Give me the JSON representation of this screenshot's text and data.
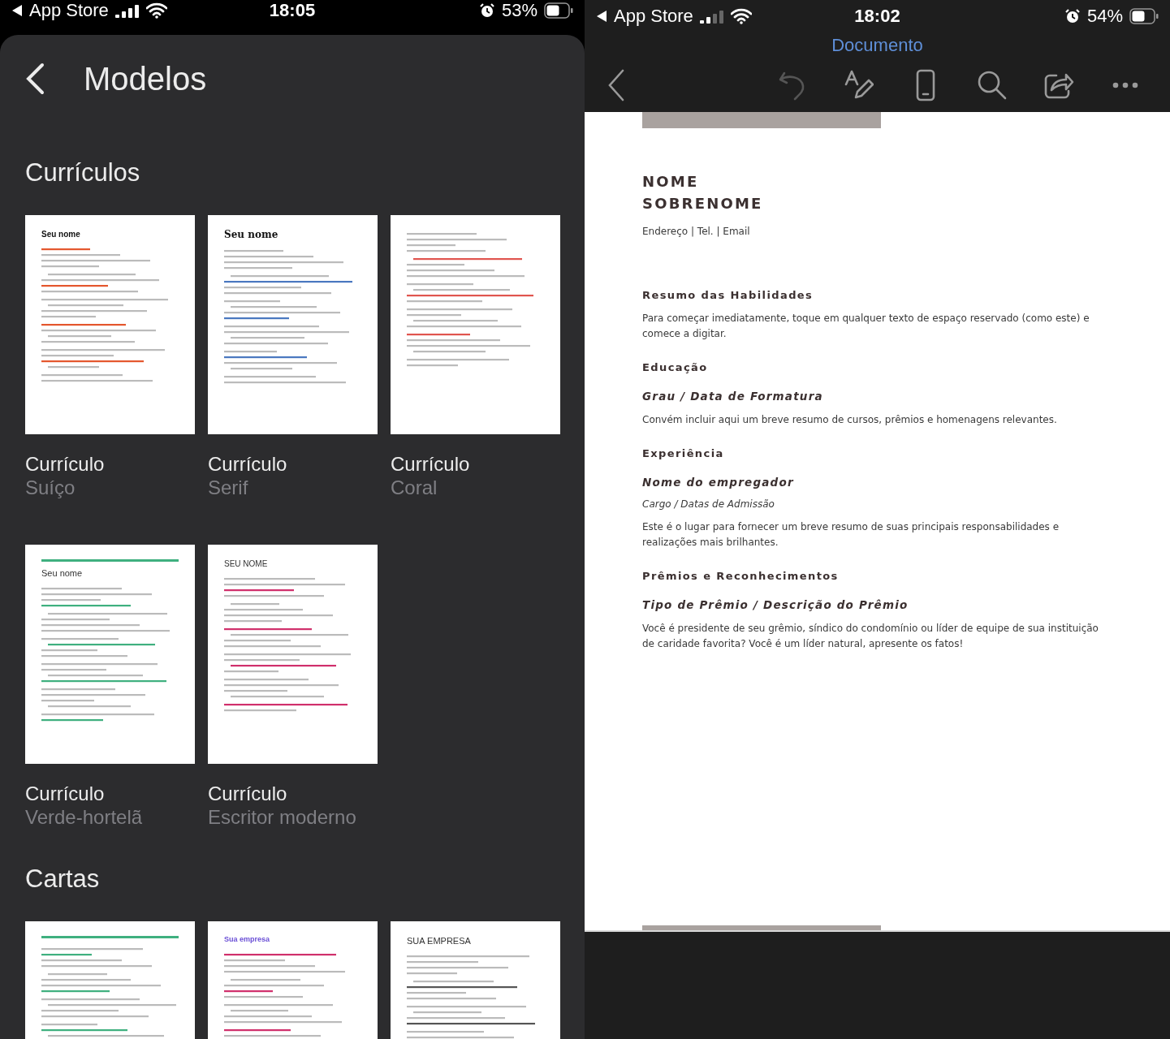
{
  "left": {
    "status_bar": {
      "back_label": "App Store",
      "time": "18:05",
      "battery": "53%"
    },
    "title": "Modelos",
    "groups": [
      {
        "title": "Currículos",
        "templates": [
          {
            "kind": "swiss",
            "heading": "Seu nome",
            "name": "Currículo",
            "variant": "Suíço"
          },
          {
            "kind": "serif",
            "heading": "Seu nome",
            "name": "Currículo",
            "variant": "Serif"
          },
          {
            "kind": "coral",
            "name": "Currículo",
            "variant": "Coral"
          },
          {
            "kind": "mint",
            "heading": "Seu nome",
            "name": "Currículo",
            "variant": "Verde-hortelã"
          },
          {
            "kind": "modern",
            "heading": "SEU NOME",
            "name": "Currículo",
            "variant": "Escritor moderno"
          }
        ]
      },
      {
        "title": "Cartas",
        "templates": [
          {
            "kind": "mint"
          },
          {
            "kind": "company",
            "heading": "Sua empresa"
          },
          {
            "kind": "caps",
            "heading": "SUA EMPRESA"
          }
        ]
      }
    ]
  },
  "right": {
    "status_bar": {
      "back_label": "App Store",
      "time": "18:02",
      "battery": "54%"
    },
    "title": "Documento",
    "toolbar": [
      {
        "kind": "undo",
        "disabled": true
      },
      {
        "kind": "format",
        "disabled": false
      },
      {
        "kind": "phone",
        "disabled": false
      },
      {
        "kind": "search",
        "disabled": false
      },
      {
        "kind": "share",
        "disabled": false
      },
      {
        "kind": "more",
        "disabled": false
      }
    ],
    "document": {
      "name_lines": [
        "NOME",
        "SOBRENOME"
      ],
      "contact": "Endereço | Tel. | Email",
      "blocks": [
        {
          "kind": "heading",
          "text": "Resumo das Habilidades"
        },
        {
          "kind": "body",
          "text": "Para começar imediatamente, toque em qualquer texto de espaço reservado (como este) e comece a digitar."
        },
        {
          "kind": "heading",
          "text": "Educação"
        },
        {
          "kind": "subheading",
          "text": "Grau / Data de Formatura"
        },
        {
          "kind": "body",
          "text": "Convém incluir aqui um breve resumo de cursos, prêmios e homenagens relevantes."
        },
        {
          "kind": "heading",
          "text": "Experiência"
        },
        {
          "kind": "subheading",
          "text": "Nome do empregador"
        },
        {
          "kind": "italic",
          "text": "Cargo / Datas de Admissão"
        },
        {
          "kind": "body",
          "text": "Este é o lugar para fornecer um breve resumo de suas principais responsabilidades e realizações mais brilhantes."
        },
        {
          "kind": "heading",
          "text": "Prêmios e Reconhecimentos"
        },
        {
          "kind": "subheading",
          "text": "Tipo de Prêmio / Descrição do Prêmio"
        },
        {
          "kind": "body",
          "text": "Você é presidente de seu grêmio, síndico do condomínio ou líder de equipe de sua instituição de caridade favorita? Você é um líder natural, apresente os fatos!"
        }
      ]
    }
  }
}
